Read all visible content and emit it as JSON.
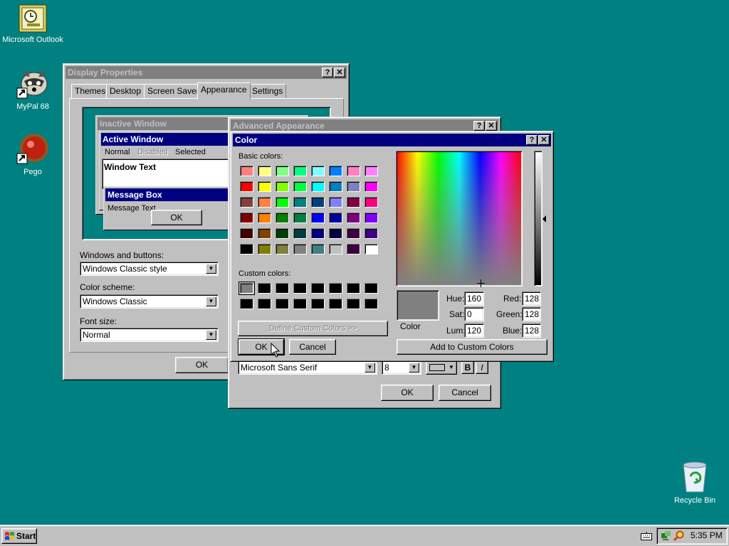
{
  "desktop": {
    "icons": [
      {
        "label": "Microsoft Outlook",
        "icon": "outlook-icon"
      },
      {
        "label": "MyPal 68",
        "icon": "mypal-icon"
      },
      {
        "label": "Pego",
        "icon": "pego-icon"
      },
      {
        "label": "Recycle Bin",
        "icon": "recycle-bin-icon"
      }
    ]
  },
  "display_properties": {
    "title": "Display Properties",
    "tabs": [
      "Themes",
      "Desktop",
      "Screen Saver",
      "Appearance",
      "Settings"
    ],
    "active_tab": "Appearance",
    "preview": {
      "inactive_window": "Inactive Window",
      "active_window": "Active Window",
      "menu": [
        "Normal",
        "Disabled",
        "Selected"
      ],
      "window_text": "Window Text",
      "message_box": "Message Box",
      "message_text": "Message Text",
      "ok": "OK"
    },
    "windows_buttons_label": "Windows and buttons:",
    "windows_buttons_value": "Windows Classic style",
    "color_scheme_label": "Color scheme:",
    "color_scheme_value": "Windows Classic",
    "font_size_label": "Font size:",
    "font_size_value": "Normal",
    "ok": "OK"
  },
  "advanced_appearance": {
    "title": "Advanced Appearance",
    "font_value": "Microsoft Sans Serif",
    "size_value": "8",
    "bold": "B",
    "italic": "I",
    "ok": "OK",
    "cancel": "Cancel"
  },
  "color_dialog": {
    "title": "Color",
    "basic_colors_label": "Basic colors:",
    "custom_colors_label": "Custom colors:",
    "basic_colors": [
      "#ff8080",
      "#ffff80",
      "#80ff80",
      "#00ff80",
      "#80ffff",
      "#0080ff",
      "#ff80c0",
      "#ff80ff",
      "#ff0000",
      "#ffff00",
      "#80ff00",
      "#00ff40",
      "#00ffff",
      "#0080c0",
      "#8080c0",
      "#ff00ff",
      "#804040",
      "#ff8040",
      "#00ff00",
      "#008080",
      "#004080",
      "#8080ff",
      "#800040",
      "#ff0080",
      "#800000",
      "#ff8000",
      "#008000",
      "#008040",
      "#0000ff",
      "#0000a0",
      "#800080",
      "#8000ff",
      "#400000",
      "#804000",
      "#004000",
      "#004040",
      "#000080",
      "#000040",
      "#400040",
      "#400080",
      "#000000",
      "#808000",
      "#808040",
      "#808080",
      "#408080",
      "#c0c0c0",
      "#400040",
      "#ffffff"
    ],
    "custom_colors": [
      "#808080",
      "#000000",
      "#000000",
      "#000000",
      "#000000",
      "#000000",
      "#000000",
      "#000000",
      "#000000",
      "#000000",
      "#000000",
      "#000000",
      "#000000",
      "#000000",
      "#000000",
      "#000000"
    ],
    "define_custom": "Define Custom Colors >>",
    "ok": "OK",
    "cancel": "Cancel",
    "color_solid_label": "Color",
    "selected_color": "#808080",
    "hue_label": "Hue:",
    "hue": "160",
    "sat_label": "Sat:",
    "sat": "0",
    "lum_label": "Lum:",
    "lum": "120",
    "red_label": "Red:",
    "red": "128",
    "green_label": "Green:",
    "green": "128",
    "blue_label": "Blue:",
    "blue": "128",
    "add_custom": "Add to Custom Colors"
  },
  "taskbar": {
    "start": "Start",
    "clock": "5:35 PM"
  }
}
